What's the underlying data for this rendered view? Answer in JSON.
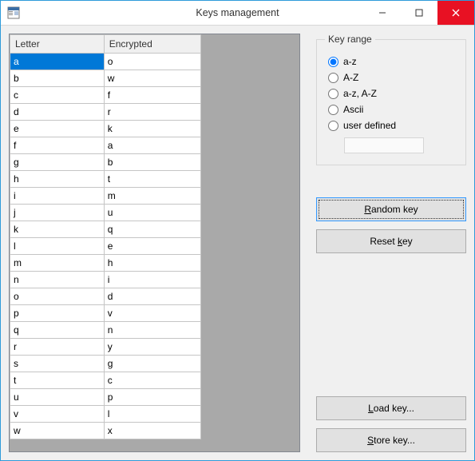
{
  "window": {
    "title": "Keys management"
  },
  "grid": {
    "headers": {
      "letter": "Letter",
      "encrypted": "Encrypted"
    },
    "rows": [
      {
        "letter": "a",
        "encrypted": "o",
        "selected": true
      },
      {
        "letter": "b",
        "encrypted": "w"
      },
      {
        "letter": "c",
        "encrypted": "f"
      },
      {
        "letter": "d",
        "encrypted": "r"
      },
      {
        "letter": "e",
        "encrypted": "k"
      },
      {
        "letter": "f",
        "encrypted": "a"
      },
      {
        "letter": "g",
        "encrypted": "b"
      },
      {
        "letter": "h",
        "encrypted": "t"
      },
      {
        "letter": "i",
        "encrypted": "m"
      },
      {
        "letter": "j",
        "encrypted": "u"
      },
      {
        "letter": "k",
        "encrypted": "q"
      },
      {
        "letter": "l",
        "encrypted": "e"
      },
      {
        "letter": "m",
        "encrypted": "h"
      },
      {
        "letter": "n",
        "encrypted": "i"
      },
      {
        "letter": "o",
        "encrypted": "d"
      },
      {
        "letter": "p",
        "encrypted": "v"
      },
      {
        "letter": "q",
        "encrypted": "n"
      },
      {
        "letter": "r",
        "encrypted": "y"
      },
      {
        "letter": "s",
        "encrypted": "g"
      },
      {
        "letter": "t",
        "encrypted": "c"
      },
      {
        "letter": "u",
        "encrypted": "p"
      },
      {
        "letter": "v",
        "encrypted": "l"
      },
      {
        "letter": "w",
        "encrypted": "x"
      }
    ]
  },
  "keyrange": {
    "legend": "Key range",
    "options": [
      {
        "label": "a-z",
        "checked": true
      },
      {
        "label": "A-Z",
        "checked": false
      },
      {
        "label": "a-z, A-Z",
        "checked": false
      },
      {
        "label": "Ascii",
        "checked": false
      },
      {
        "label": "user defined",
        "checked": false
      }
    ],
    "userdef_value": ""
  },
  "buttons": {
    "random": {
      "pre": "",
      "hot": "R",
      "post": "andom key"
    },
    "reset": {
      "pre": "Reset ",
      "hot": "k",
      "post": "ey"
    },
    "load": {
      "pre": "",
      "hot": "L",
      "post": "oad key..."
    },
    "store": {
      "pre": "",
      "hot": "S",
      "post": "tore key..."
    }
  }
}
